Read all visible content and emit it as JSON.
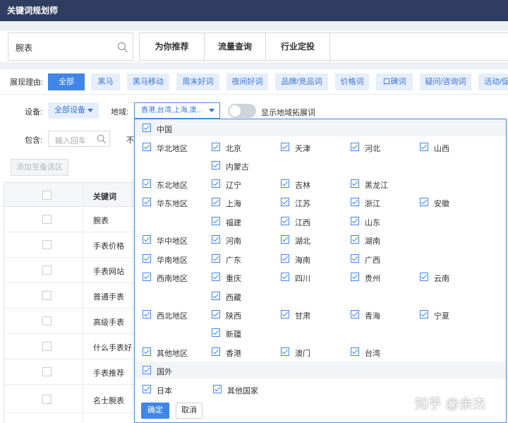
{
  "app": {
    "title": "关键词规划师"
  },
  "search": {
    "value": "腕表"
  },
  "tabs": [
    "为你推荐",
    "流量查询",
    "行业定投"
  ],
  "reasons": {
    "label": "展现理由:",
    "items": [
      "全部",
      "黑马",
      "黑马移动",
      "周末好词",
      "夜间好词",
      "品牌/竞品词",
      "价格词",
      "口碑词",
      "疑问/咨询词",
      "活动/促"
    ]
  },
  "filters": {
    "device_label": "设备:",
    "device_value": "全部设备",
    "region_label": "地域:",
    "region_value": "香港,台湾,上海,澳...",
    "toggle_label": "显示地域拓展词",
    "include_label": "包含:",
    "include_placeholder": "输入回车",
    "cut_text": "不"
  },
  "table": {
    "add_button": "添加至备选区",
    "header": "关键词",
    "rows": [
      "腕表",
      "手表价格",
      "手表网站",
      "普通手表",
      "高级手表",
      "什么手表好",
      "手表推荐",
      "名士腕表"
    ]
  },
  "region_dropdown": {
    "china": "中国",
    "regions": [
      {
        "name": "华北地区",
        "provinces": [
          "北京",
          "天津",
          "河北",
          "山西",
          "内蒙古"
        ]
      },
      {
        "name": "东北地区",
        "provinces": [
          "辽宁",
          "吉林",
          "黑龙江"
        ]
      },
      {
        "name": "华东地区",
        "provinces": [
          "上海",
          "江苏",
          "浙江",
          "安徽",
          "福建",
          "江西",
          "山东"
        ]
      },
      {
        "name": "华中地区",
        "provinces": [
          "河南",
          "湖北",
          "湖南"
        ]
      },
      {
        "name": "华南地区",
        "provinces": [
          "广东",
          "海南",
          "广西"
        ]
      },
      {
        "name": "西南地区",
        "provinces": [
          "重庆",
          "四川",
          "贵州",
          "云南",
          "西藏"
        ]
      },
      {
        "name": "西北地区",
        "provinces": [
          "陕西",
          "甘肃",
          "青海",
          "宁夏",
          "新疆"
        ]
      },
      {
        "name": "其他地区",
        "provinces": [
          "香港",
          "澳门",
          "台湾"
        ]
      }
    ],
    "abroad": "国外",
    "abroad_items": [
      "日本",
      "其他国家"
    ],
    "confirm": "确定",
    "cancel": "取消"
  },
  "watermark": "知乎 @余杰",
  "colors": {
    "titlebar": "#2f3d60",
    "accent": "#3f86e7",
    "chip_bg": "#e6eefc"
  }
}
